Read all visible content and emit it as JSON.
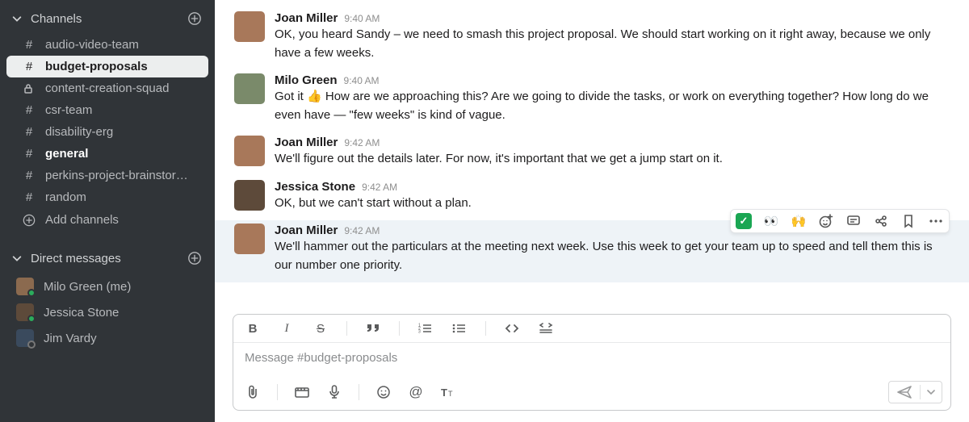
{
  "sidebar": {
    "channels_header": "Channels",
    "channels": [
      {
        "icon": "hash",
        "label": "audio-video-team",
        "active": false,
        "bold": false
      },
      {
        "icon": "hash",
        "label": "budget-proposals",
        "active": true,
        "bold": false
      },
      {
        "icon": "lock",
        "label": "content-creation-squad",
        "active": false,
        "bold": false
      },
      {
        "icon": "hash",
        "label": "csr-team",
        "active": false,
        "bold": false
      },
      {
        "icon": "hash",
        "label": "disability-erg",
        "active": false,
        "bold": false
      },
      {
        "icon": "hash",
        "label": "general",
        "active": false,
        "bold": true
      },
      {
        "icon": "hash",
        "label": "perkins-project-brainstor…",
        "active": false,
        "bold": false
      },
      {
        "icon": "hash",
        "label": "random",
        "active": false,
        "bold": false
      }
    ],
    "add_channels": "Add channels",
    "dms_header": "Direct messages",
    "dms": [
      {
        "label": "Milo Green (me)",
        "color": "#8b6a4f",
        "presence": "online"
      },
      {
        "label": "Jessica Stone",
        "color": "#5d4a3a",
        "presence": "online"
      },
      {
        "label": "Jim Vardy",
        "color": "#3a4a5d",
        "presence": "away"
      }
    ]
  },
  "messages": [
    {
      "author": "Joan Miller",
      "time": "9:40 AM",
      "avatar_color": "#a8785a",
      "text": "OK, you heard Sandy – we need to smash this project proposal. We should start working on it right away, because we only have a few weeks."
    },
    {
      "author": "Milo Green",
      "time": "9:40 AM",
      "avatar_color": "#7a8a6a",
      "text_pre": "Got it ",
      "emoji": "👍",
      "text_post": " How are we approaching this? Are we going to divide the tasks, or work on everything together? How long do we even have — \"few weeks\" is kind of vague."
    },
    {
      "author": "Joan Miller",
      "time": "9:42 AM",
      "avatar_color": "#a8785a",
      "text": "We'll figure out the details later. For now, it's important that we get a jump start on it."
    },
    {
      "author": "Jessica Stone",
      "time": "9:42 AM",
      "avatar_color": "#5d4a3a",
      "text": "OK, but we can't start without a plan."
    },
    {
      "author": "Joan Miller",
      "time": "9:42 AM",
      "avatar_color": "#a8785a",
      "hovered": true,
      "text": "We'll hammer out the particulars at the meeting next week. Use this week to get your team up to speed and tell them this is our number one priority."
    }
  ],
  "hover_actions": {
    "eyes": "👀",
    "hands": "🙌"
  },
  "composer": {
    "placeholder": "Message #budget-proposals"
  }
}
